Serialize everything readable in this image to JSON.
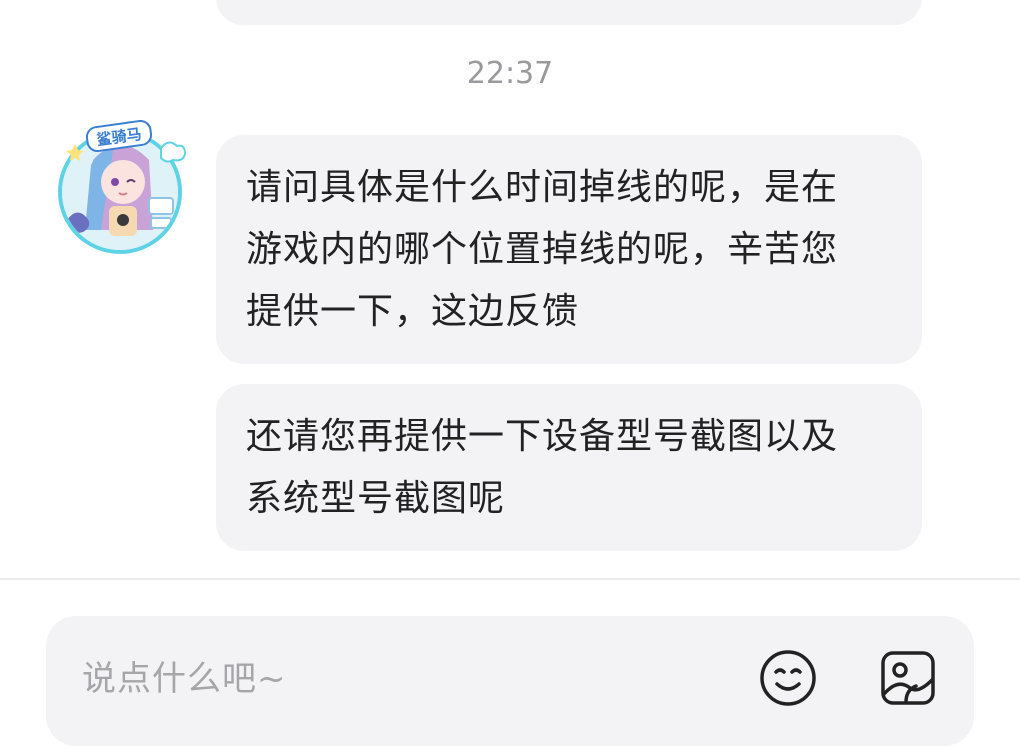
{
  "chat": {
    "timestamp": "22:37",
    "messages": [
      {
        "sender": "agent",
        "lines": [
          "请问具体是什么时间掉线的呢，是在",
          "游戏内的哪个位置掉线的呢，辛苦您",
          "提供一下，这边反馈"
        ]
      },
      {
        "sender": "agent",
        "lines": [
          "还请您再提供一下设备型号截图以及",
          "系统型号截图呢"
        ]
      }
    ],
    "avatar": {
      "icon": "agent-avatar",
      "badge_text": "鲨骑马"
    }
  },
  "input": {
    "placeholder": "说点什么吧~",
    "emoji_icon": "smile-emoji-icon",
    "image_icon": "image-picture-icon"
  },
  "colors": {
    "bubble_bg": "#f3f3f6",
    "text": "#222222",
    "timestamp": "#9a9a9e",
    "placeholder": "#a6a6aa",
    "avatar_ring": "#5fd3e6"
  }
}
